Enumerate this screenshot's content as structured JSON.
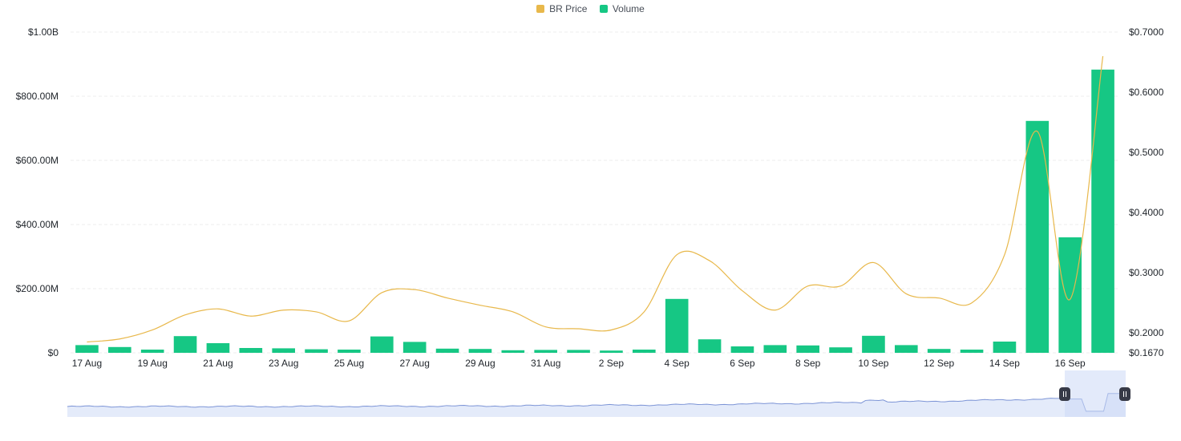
{
  "legend": {
    "price_label": "BR Price",
    "volume_label": "Volume"
  },
  "colors": {
    "price": "#e8b84b",
    "volume": "#16c784",
    "grid": "#eeeeee",
    "navigator_fill": "#e4ebfa",
    "navigator_line": "#7c94d6",
    "navigator_window": "#ccd8f6",
    "handle": "#373a47"
  },
  "chart_data": {
    "type": "bar",
    "categories": [
      "17 Aug",
      "18 Aug",
      "19 Aug",
      "20 Aug",
      "21 Aug",
      "22 Aug",
      "23 Aug",
      "24 Aug",
      "25 Aug",
      "26 Aug",
      "27 Aug",
      "28 Aug",
      "29 Aug",
      "30 Aug",
      "31 Aug",
      "1 Sep",
      "2 Sep",
      "3 Sep",
      "4 Sep",
      "5 Sep",
      "6 Sep",
      "7 Sep",
      "8 Sep",
      "9 Sep",
      "10 Sep",
      "11 Sep",
      "12 Sep",
      "13 Sep",
      "14 Sep",
      "15 Sep",
      "16 Sep",
      "17 Sep"
    ],
    "x_tick_labels": [
      "17 Aug",
      "19 Aug",
      "21 Aug",
      "23 Aug",
      "25 Aug",
      "27 Aug",
      "29 Aug",
      "31 Aug",
      "2 Sep",
      "4 Sep",
      "6 Sep",
      "8 Sep",
      "10 Sep",
      "12 Sep",
      "14 Sep",
      "16 Sep"
    ],
    "series": [
      {
        "name": "Volume",
        "type": "bar",
        "axis": "left",
        "values": [
          24000000,
          18000000,
          10000000,
          52000000,
          30000000,
          15000000,
          14000000,
          11000000,
          10000000,
          51000000,
          34000000,
          13000000,
          12000000,
          8000000,
          9000000,
          9000000,
          7000000,
          10000000,
          168000000,
          42000000,
          20000000,
          24000000,
          23000000,
          17000000,
          53000000,
          24000000,
          12000000,
          10000000,
          35000000,
          723000000,
          360000000,
          883000000
        ]
      },
      {
        "name": "BR Price",
        "type": "line",
        "axis": "right",
        "x": [
          "17 Aug",
          "18 Aug",
          "19 Aug",
          "20 Aug",
          "21 Aug",
          "22 Aug",
          "23 Aug",
          "24 Aug",
          "25 Aug",
          "26 Aug",
          "27 Aug",
          "28 Aug",
          "29 Aug",
          "30 Aug",
          "31 Aug",
          "1 Sep",
          "2 Sep",
          "3 Sep",
          "4 Sep",
          "5 Sep",
          "6 Sep",
          "7 Sep",
          "8 Sep",
          "9 Sep",
          "10 Sep",
          "11 Sep",
          "12 Sep",
          "13 Sep",
          "14 Sep",
          "15 Sep",
          "16 Sep",
          "17 Sep"
        ],
        "values": [
          0.185,
          0.19,
          0.205,
          0.23,
          0.24,
          0.228,
          0.238,
          0.235,
          0.22,
          0.267,
          0.272,
          0.258,
          0.246,
          0.235,
          0.21,
          0.207,
          0.205,
          0.235,
          0.33,
          0.32,
          0.27,
          0.238,
          0.278,
          0.278,
          0.317,
          0.265,
          0.258,
          0.25,
          0.33,
          0.535,
          0.256,
          0.66
        ]
      }
    ],
    "y_left": {
      "ticks": [
        "$0",
        "$200.00M",
        "$400.00M",
        "$600.00M",
        "$800.00M",
        "$1.00B"
      ],
      "range": [
        0,
        1000000000
      ]
    },
    "y_right": {
      "ticks": [
        "$0.1670",
        "$0.2000",
        "$0.3000",
        "$0.4000",
        "$0.5000",
        "$0.6000",
        "$0.7000"
      ],
      "range": [
        0.167,
        0.7
      ]
    },
    "grid": true,
    "legend_position": "top-center",
    "navigator": true
  }
}
